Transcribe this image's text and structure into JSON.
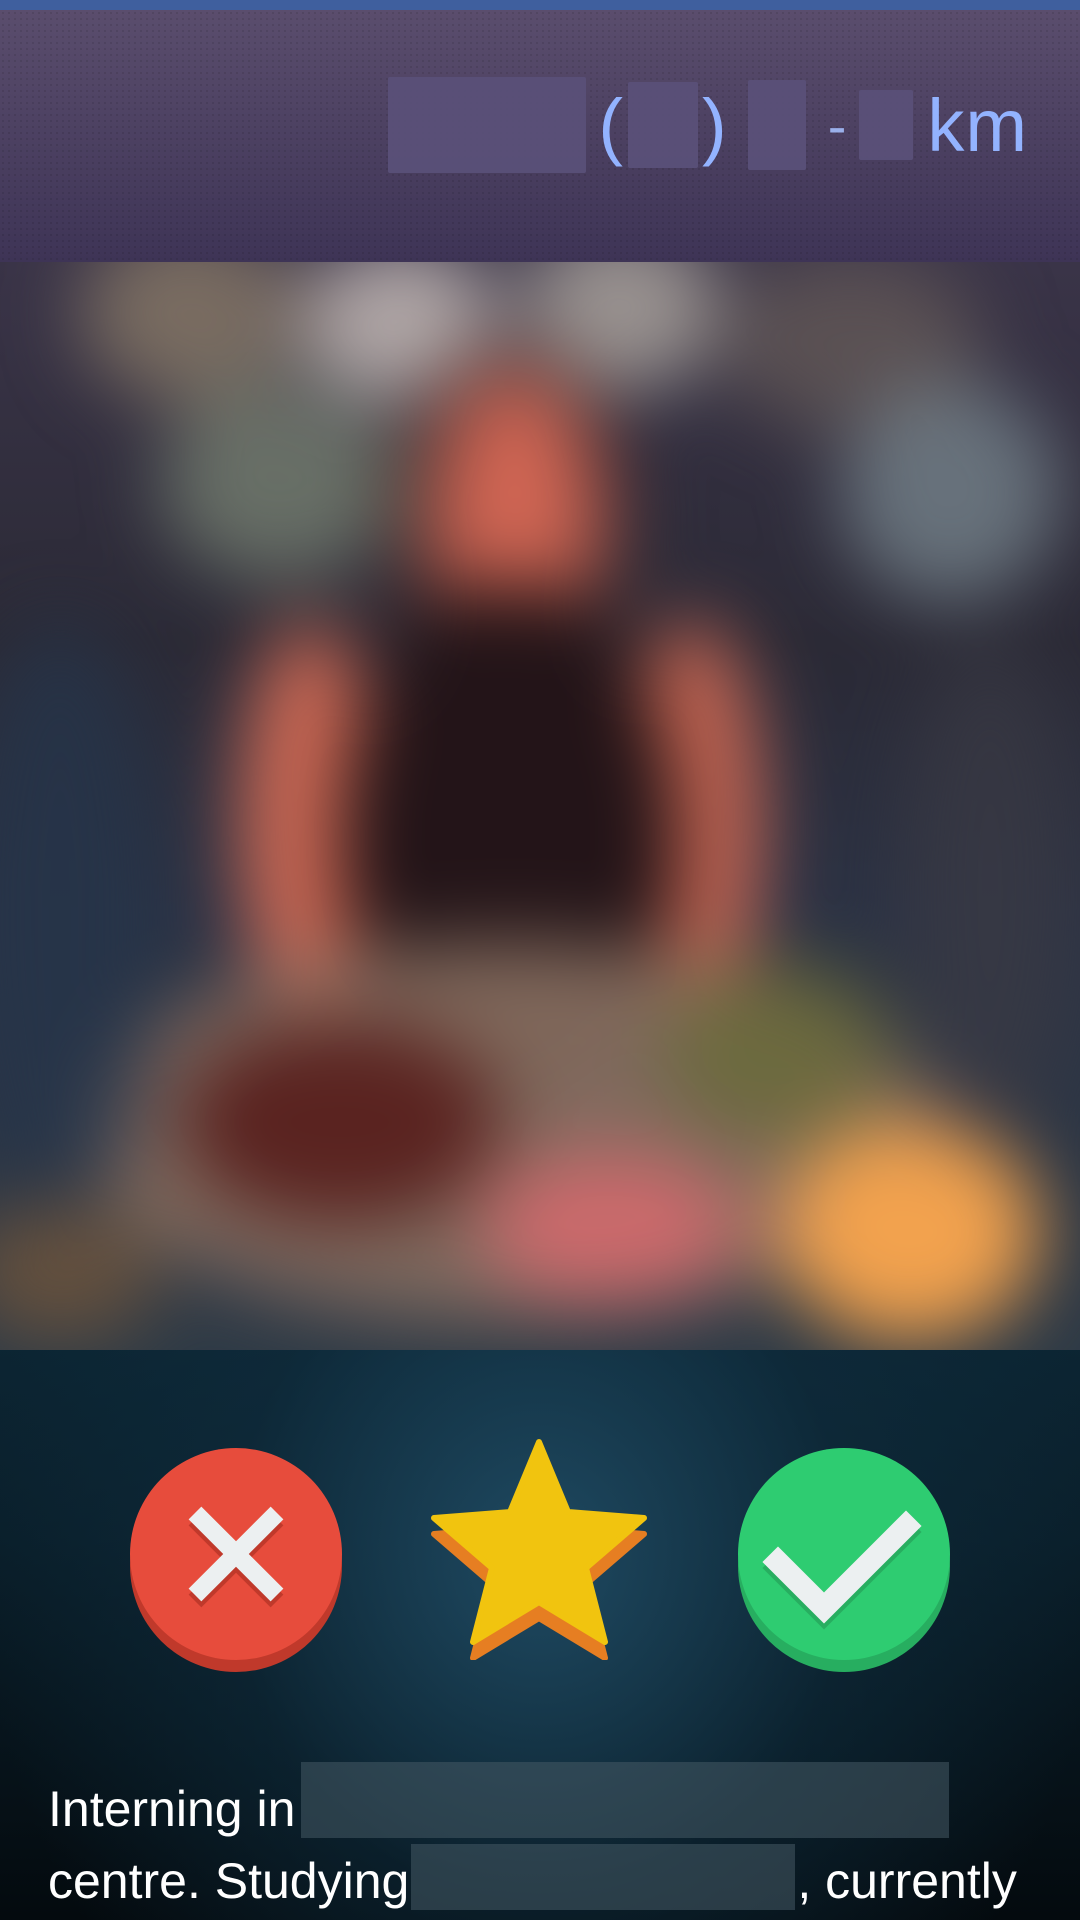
{
  "header": {
    "name_redacted": "",
    "age_open": "(",
    "age_close": ")",
    "distance_separator": "-",
    "distance_unit": "km"
  },
  "profile_photo": {
    "description": "blurred profile photo"
  },
  "actions": {
    "nope": "nope-icon",
    "super_like": "star-icon",
    "like": "check-icon"
  },
  "colors": {
    "nope": "#e74c3c",
    "super_like": "#f1c40f",
    "like": "#2ecc71",
    "header_text": "#93b3ff"
  },
  "bio": {
    "line1": "Interning in",
    "line2_start": "centre. Studying",
    "line2_end": ", currently"
  }
}
